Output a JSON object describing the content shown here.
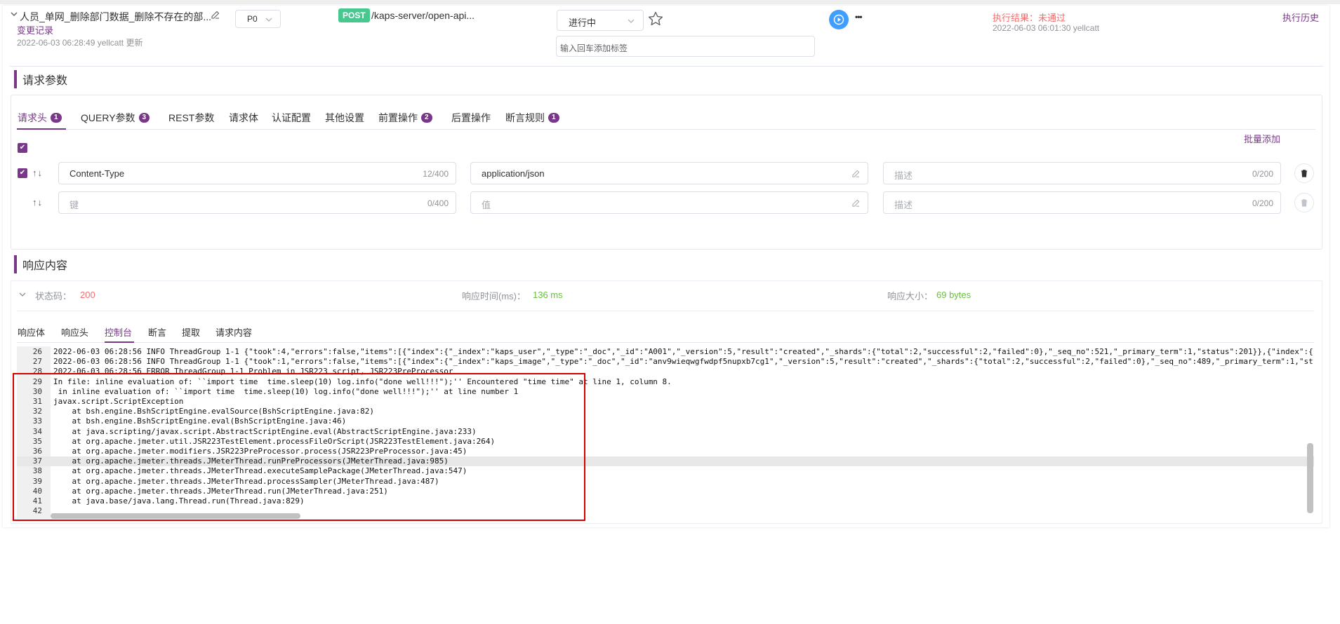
{
  "header": {
    "case_name": "人员_单网_删除部门数据_删除不存在的部...",
    "change_log": "变更记录",
    "updated_info": "2022-06-03 06:28:49 yellcatt 更新",
    "priority": "P0",
    "method": "POST",
    "url": "/kaps-server/open-api...",
    "status": "进行中",
    "tag_placeholder": "输入回车添加标签",
    "result": "执行结果：未通过",
    "result_time": "2022-06-03 06:01:30 yellcatt",
    "history": "执行历史",
    "more": "•••"
  },
  "colors": {
    "accent": "#783887",
    "post": "#48c78e",
    "run_button": "#409eff",
    "fail": "#f56c6c",
    "success": "#67c23a",
    "highlight_border": "#d40000"
  },
  "request": {
    "title": "请求参数",
    "tabs": [
      {
        "label": "请求头",
        "badge": "1"
      },
      {
        "label": "QUERY参数",
        "badge": "3"
      },
      {
        "label": "REST参数",
        "badge": ""
      },
      {
        "label": "请求体",
        "badge": ""
      },
      {
        "label": "认证配置",
        "badge": ""
      },
      {
        "label": "其他设置",
        "badge": ""
      },
      {
        "label": "前置操作",
        "badge": "2"
      },
      {
        "label": "后置操作",
        "badge": ""
      },
      {
        "label": "断言规则",
        "badge": "1"
      }
    ],
    "batch_add": "批量添加",
    "rows": [
      {
        "key": "Content-Type",
        "key_count": "12/400",
        "value": "application/json",
        "desc_placeholder": "描述",
        "desc_count": "0/200",
        "arrows": "↑↓"
      },
      {
        "key_placeholder": "键",
        "key_count": "0/400",
        "value_placeholder": "值",
        "desc_placeholder": "描述",
        "desc_count": "0/200",
        "arrows": "↑↓"
      }
    ]
  },
  "response": {
    "title": "响应内容",
    "status_label": "状态码：",
    "status_value": "200",
    "time_label": "响应时间(ms)：",
    "time_value": "136 ms",
    "size_label": "响应大小：",
    "size_value": "69 bytes",
    "tabs": [
      "响应体",
      "响应头",
      "控制台",
      "断言",
      "提取",
      "请求内容"
    ],
    "console_lines": [
      {
        "n": "26",
        "t": "2022-06-03 06:28:56 INFO ThreadGroup 1-1 {\"took\":4,\"errors\":false,\"items\":[{\"index\":{\"_index\":\"kaps_user\",\"_type\":\"_doc\",\"_id\":\"A001\",\"_version\":5,\"result\":\"created\",\"_shards\":{\"total\":2,\"successful\":2,\"failed\":0},\"_seq_no\":521,\"_primary_term\":1,\"status\":201}},{\"index\":{"
      },
      {
        "n": "27",
        "t": "2022-06-03 06:28:56 INFO ThreadGroup 1-1 {\"took\":1,\"errors\":false,\"items\":[{\"index\":{\"_index\":\"kaps_image\",\"_type\":\"_doc\",\"_id\":\"anv9wieqwgfwdpf5nupxb7cg1\",\"_version\":5,\"result\":\"created\",\"_shards\":{\"total\":2,\"successful\":2,\"failed\":0},\"_seq_no\":489,\"_primary_term\":1,\"st"
      },
      {
        "n": "28",
        "t": "2022-06-03 06:28:56 ERROR ThreadGroup 1-1 Problem in JSR223 script, JSR223PreProcessor"
      },
      {
        "n": "29",
        "t": "In file: inline evaluation of: ``import time  time.sleep(10) log.info(\"done well!!!\");'' Encountered \"time time\" at line 1, column 8."
      },
      {
        "n": "30",
        "t": " in inline evaluation of: ``import time  time.sleep(10) log.info(\"done well!!!\");'' at line number 1"
      },
      {
        "n": "31",
        "t": "javax.script.ScriptException"
      },
      {
        "n": "32",
        "t": "    at bsh.engine.BshScriptEngine.evalSource(BshScriptEngine.java:82)"
      },
      {
        "n": "33",
        "t": "    at bsh.engine.BshScriptEngine.eval(BshScriptEngine.java:46)"
      },
      {
        "n": "34",
        "t": "    at java.scripting/javax.script.AbstractScriptEngine.eval(AbstractScriptEngine.java:233)"
      },
      {
        "n": "35",
        "t": "    at org.apache.jmeter.util.JSR223TestElement.processFileOrScript(JSR223TestElement.java:264)"
      },
      {
        "n": "36",
        "t": "    at org.apache.jmeter.modifiers.JSR223PreProcessor.process(JSR223PreProcessor.java:45)"
      },
      {
        "n": "37",
        "t": "    at org.apache.jmeter.threads.JMeterThread.runPreProcessors(JMeterThread.java:985)"
      },
      {
        "n": "38",
        "t": "    at org.apache.jmeter.threads.JMeterThread.executeSamplePackage(JMeterThread.java:547)"
      },
      {
        "n": "39",
        "t": "    at org.apache.jmeter.threads.JMeterThread.processSampler(JMeterThread.java:487)"
      },
      {
        "n": "40",
        "t": "    at org.apache.jmeter.threads.JMeterThread.run(JMeterThread.java:251)"
      },
      {
        "n": "41",
        "t": "    at java.base/java.lang.Thread.run(Thread.java:829)"
      },
      {
        "n": "42",
        "t": ""
      }
    ]
  }
}
